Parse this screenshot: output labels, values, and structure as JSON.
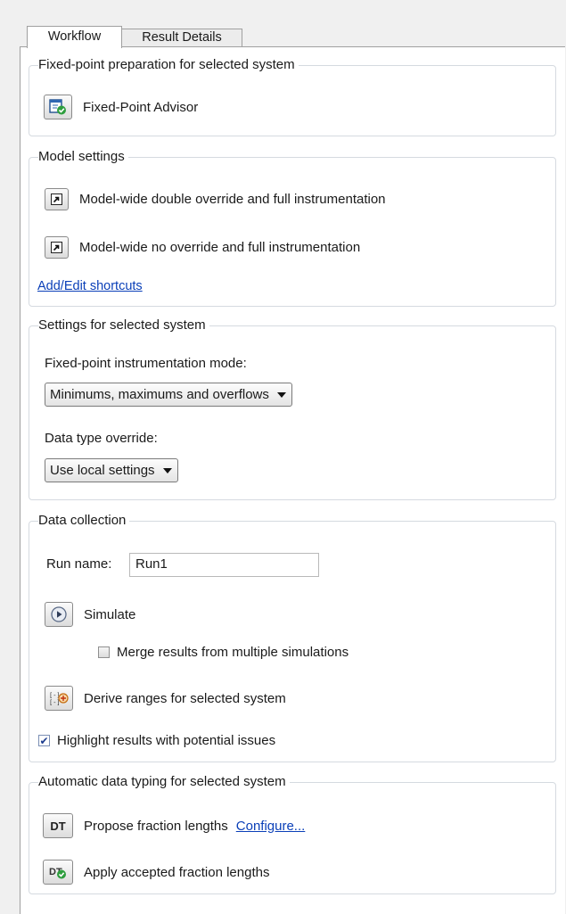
{
  "tabs": {
    "workflow": "Workflow",
    "result_details": "Result Details"
  },
  "prep": {
    "legend": "Fixed-point preparation for selected system",
    "advisor_label": "Fixed-Point Advisor"
  },
  "model": {
    "legend": "Model settings",
    "shortcut1": "Model-wide double override and full instrumentation",
    "shortcut2": "Model-wide no override and full instrumentation",
    "add_edit": "Add/Edit shortcuts"
  },
  "settings": {
    "legend": "Settings for selected system",
    "mode_label": "Fixed-point instrumentation mode:",
    "mode_value": "Minimums, maximums and overflows",
    "dto_label": "Data type override:",
    "dto_value": "Use local settings"
  },
  "collection": {
    "legend": "Data collection",
    "run_name_label": "Run name:",
    "run_name_value": "Run1",
    "simulate": "Simulate",
    "merge": "Merge results from multiple simulations",
    "merge_checked": false,
    "derive": "Derive ranges for selected system",
    "highlight": "Highlight results with potential issues",
    "highlight_checked": true
  },
  "autotype": {
    "legend": "Automatic data typing for selected system",
    "dt_icon_text": "DT",
    "propose": "Propose fraction lengths",
    "configure": "Configure...",
    "apply": "Apply accepted fraction lengths"
  }
}
